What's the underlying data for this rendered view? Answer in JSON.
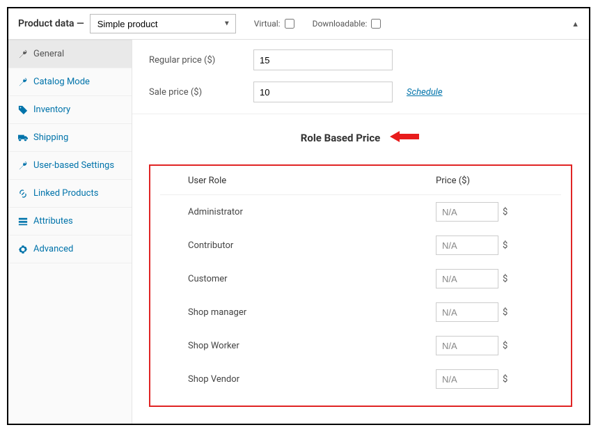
{
  "header": {
    "title": "Product data —",
    "productType": "Simple product",
    "virtual_label": "Virtual:",
    "downloadable_label": "Downloadable:"
  },
  "sidebar": {
    "items": [
      {
        "label": "General",
        "active": true,
        "icon": "wrench"
      },
      {
        "label": "Catalog Mode",
        "icon": "wrench"
      },
      {
        "label": "Inventory",
        "icon": "tag"
      },
      {
        "label": "Shipping",
        "icon": "truck"
      },
      {
        "label": "User-based Settings",
        "icon": "wrench"
      },
      {
        "label": "Linked Products",
        "icon": "link"
      },
      {
        "label": "Attributes",
        "icon": "list"
      },
      {
        "label": "Advanced",
        "icon": "gear"
      }
    ]
  },
  "pricing": {
    "regular_label": "Regular price ($)",
    "regular_value": "15",
    "sale_label": "Sale price ($)",
    "sale_value": "10",
    "schedule_label": "Schedule"
  },
  "roleSection": {
    "heading": "Role Based Price",
    "col_role": "User Role",
    "col_price": "Price ($)",
    "placeholder": "N/A",
    "currency": "$",
    "rows": [
      {
        "name": "Administrator"
      },
      {
        "name": "Contributor"
      },
      {
        "name": "Customer"
      },
      {
        "name": "Shop manager"
      },
      {
        "name": "Shop Worker"
      },
      {
        "name": "Shop Vendor"
      }
    ]
  }
}
